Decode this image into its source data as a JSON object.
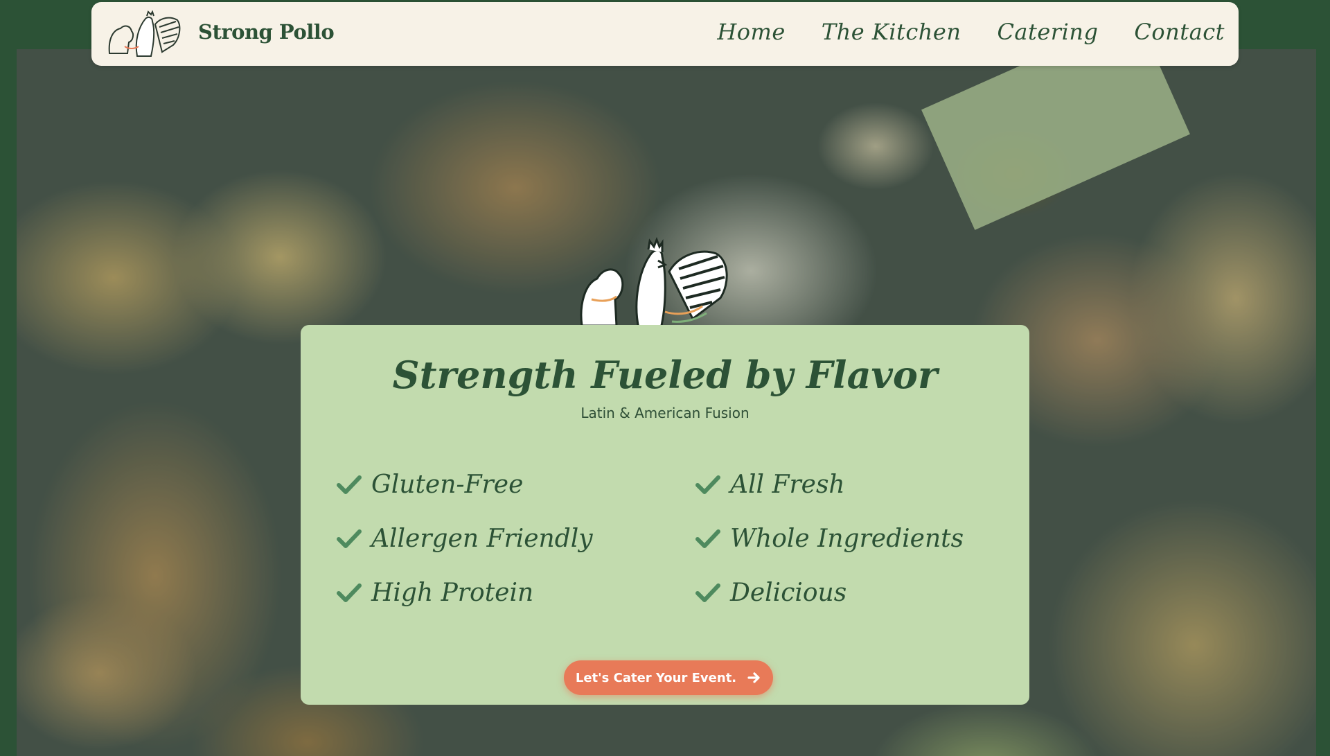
{
  "brand": {
    "name": "Strong Pollo",
    "logo_icon": "flexing-rooster-logo"
  },
  "nav": {
    "items": [
      {
        "label": "Home"
      },
      {
        "label": "The Kitchen"
      },
      {
        "label": "Catering"
      },
      {
        "label": "Contact"
      }
    ]
  },
  "hero": {
    "title": "Strength Fueled by Flavor",
    "subtitle": "Latin & American Fusion",
    "features": [
      {
        "label": "Gluten-Free",
        "icon": "check-icon"
      },
      {
        "label": "All Fresh",
        "icon": "check-icon"
      },
      {
        "label": "Allergen Friendly",
        "icon": "check-icon"
      },
      {
        "label": "Whole Ingredients",
        "icon": "check-icon"
      },
      {
        "label": "High Protein",
        "icon": "check-icon"
      },
      {
        "label": "Delicious",
        "icon": "check-icon"
      }
    ],
    "cta_label": "Let's Cater Your Event.",
    "cta_icon": "arrow-right-icon"
  },
  "colors": {
    "brand_green": "#2c5236",
    "nav_bg": "#f7f2e7",
    "card_bg": "#c2dbae",
    "check_green": "#4e8a5e",
    "cta_orange": "#e87a58"
  }
}
